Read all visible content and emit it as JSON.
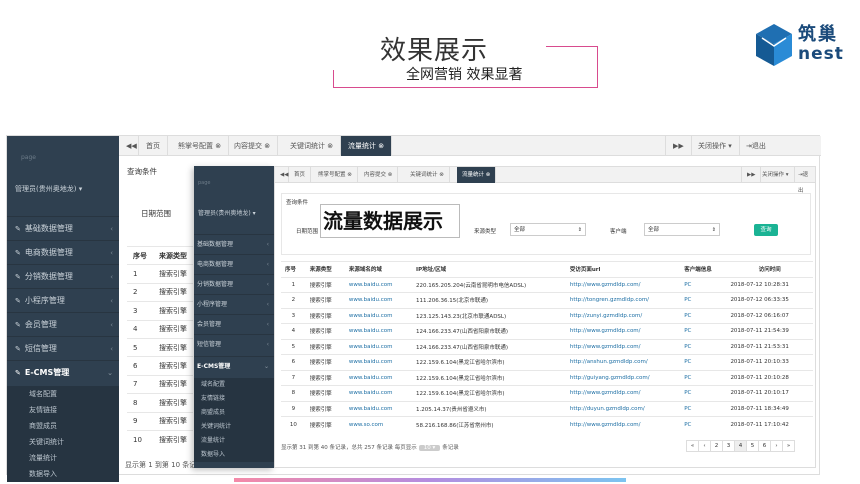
{
  "header": {
    "title": "效果展示",
    "subtitle": "全网营销 效果显著"
  },
  "logo": {
    "cn": "筑巢",
    "en": "nest",
    "color": "#1b4b7b"
  },
  "back_window": {
    "page_label": "page",
    "admin": "管理员(贵州奥地龙)",
    "menu": [
      {
        "label": "基础数据管理"
      },
      {
        "label": "电商数据管理"
      },
      {
        "label": "分销数据管理"
      },
      {
        "label": "小程序管理"
      },
      {
        "label": "会员管理"
      },
      {
        "label": "短信管理"
      },
      {
        "label": "E-CMS管理"
      }
    ],
    "submenu": [
      "域名配置",
      "友情链接",
      "商盟成员",
      "关键词统计",
      "流量统计",
      "数据导入"
    ],
    "tabs": [
      "首页",
      "熊掌号配置",
      "内容提交",
      "关键词统计",
      "流量统计"
    ],
    "tab_nav_left": "◀◀",
    "tab_nav_right": "▶▶",
    "close_ops": "关闭操作",
    "logout": "退出",
    "query_title": "查询条件",
    "date_range": "日期范围",
    "columns": [
      "序号",
      "来源类型"
    ],
    "rows": [
      [
        "1",
        "搜索引擎"
      ],
      [
        "2",
        "搜索引擎"
      ],
      [
        "3",
        "搜索引擎"
      ],
      [
        "4",
        "搜索引擎"
      ],
      [
        "5",
        "搜索引擎"
      ],
      [
        "6",
        "搜索引擎"
      ],
      [
        "7",
        "搜索引擎"
      ],
      [
        "8",
        "搜索引擎"
      ],
      [
        "9",
        "搜索引擎"
      ],
      [
        "10",
        "搜索引擎"
      ]
    ],
    "footer": "显示第 1 到第 10 条记"
  },
  "front_window": {
    "page_label": "page",
    "admin": "管理员(贵州奥地龙)",
    "menu": [
      {
        "label": "基础数据管理"
      },
      {
        "label": "电商数据管理"
      },
      {
        "label": "分销数据管理"
      },
      {
        "label": "小程序管理"
      },
      {
        "label": "会员管理"
      },
      {
        "label": "短信管理"
      },
      {
        "label": "E-CMS管理"
      }
    ],
    "submenu": [
      "域名配置",
      "友情链接",
      "商盟成员",
      "关键词统计",
      "流量统计",
      "数据导入"
    ],
    "tabs": [
      "首页",
      "熊掌号配置",
      "内容提交",
      "关键词统计",
      "流量统计"
    ],
    "close_ops": "关闭操作",
    "logout": "退出",
    "query_title": "查询条件",
    "date_range": "日期范围",
    "source_type_label": "来源类型",
    "source_type_value": "全部",
    "client_label": "客户端",
    "client_value": "全部",
    "query_button": "查询",
    "big_title": "流量数据展示",
    "columns": [
      "序号",
      "来源类型",
      "来源域名的域",
      "IP地址/区域",
      "受访页面url",
      "客户端信息",
      "访问时间"
    ],
    "rows": [
      [
        "1",
        "搜索引擎",
        "www.baidu.com",
        "220.165.205.204(云南省昆明市电信ADSL)",
        "http://www.gzmdldp.com/",
        "PC",
        "2018-07-12 10:28:31"
      ],
      [
        "2",
        "搜索引擎",
        "www.baidu.com",
        "111.206.36.15(北京市联通)",
        "http://tongren.gzmdldp.com/",
        "PC",
        "2018-07-12 06:33:35"
      ],
      [
        "3",
        "搜索引擎",
        "www.baidu.com",
        "123.125.143.23(北京市联通ADSL)",
        "http://zunyi.gzmdldp.com/",
        "PC",
        "2018-07-12 06:16:07"
      ],
      [
        "4",
        "搜索引擎",
        "www.baidu.com",
        "124.166.233.47(山西省阳泉市联通)",
        "http://www.gzmdldp.com/",
        "PC",
        "2018-07-11 21:54:39"
      ],
      [
        "5",
        "搜索引擎",
        "www.baidu.com",
        "124.166.233.47(山西省阳泉市联通)",
        "http://www.gzmdldp.com/",
        "PC",
        "2018-07-11 21:53:31"
      ],
      [
        "6",
        "搜索引擎",
        "www.baidu.com",
        "122.159.6.104(黑龙江省哈尔滨市)",
        "http://anshun.gzmdldp.com/",
        "PC",
        "2018-07-11 20:10:33"
      ],
      [
        "7",
        "搜索引擎",
        "www.baidu.com",
        "122.159.6.104(黑龙江省哈尔滨市)",
        "http://guiyang.gzmdldp.com/",
        "PC",
        "2018-07-11 20:10:28"
      ],
      [
        "8",
        "搜索引擎",
        "www.baidu.com",
        "122.159.6.104(黑龙江省哈尔滨市)",
        "http://www.gzmdldp.com/",
        "PC",
        "2018-07-11 20:10:17"
      ],
      [
        "9",
        "搜索引擎",
        "www.baidu.com",
        "1.205.14.37(贵州省遵义市)",
        "http://duyun.gzmdldp.com/",
        "PC",
        "2018-07-11 18:34:49"
      ],
      [
        "10",
        "搜索引擎",
        "www.so.com",
        "58.216.168.86(江苏省常州市)",
        "http://www.gzmdldp.com/",
        "PC",
        "2018-07-11 17:10:42"
      ]
    ],
    "footer_text": "显示第 31 到第 40 条记录，总共 257 条记录 每页显示",
    "page_size": "10",
    "footer_suffix": "条记录",
    "pager": [
      "«",
      "‹",
      "2",
      "3",
      "4",
      "5",
      "6",
      "›",
      "»"
    ],
    "active_page": "4"
  }
}
